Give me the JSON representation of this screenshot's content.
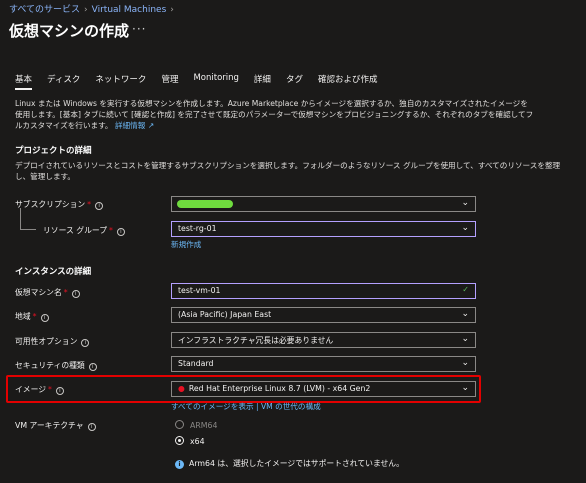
{
  "breadcrumb": {
    "item1": "すべてのサービス",
    "item2": "Virtual Machines"
  },
  "page": {
    "title": "仮想マシンの作成",
    "more": "···"
  },
  "tabs": [
    {
      "label": "基本"
    },
    {
      "label": "ディスク"
    },
    {
      "label": "ネットワーク"
    },
    {
      "label": "管理"
    },
    {
      "label": "Monitoring"
    },
    {
      "label": "詳細"
    },
    {
      "label": "タグ"
    },
    {
      "label": "確認および作成"
    }
  ],
  "intro": {
    "line1": "Linux または Windows を実行する仮想マシンを作成します。Azure Marketplace からイメージを選択するか、独自のカスタマイズされたイメージを",
    "line2": "使用します。[基本] タブに続いて [確認と作成] を完了させて既定のパラメーターで仮想マシンをプロビジョニングするか、それぞれのタブを確認してフ",
    "line3": "ルカスタマイズを行います。",
    "link": "詳細情報 ↗"
  },
  "project": {
    "heading": "プロジェクトの詳細",
    "desc1": "デプロイされているリソースとコストを管理するサブスクリプションを選択します。フォルダーのようなリソース グループを使用して、すべてのリソースを整理",
    "desc2": "し、管理します。",
    "subscription_label": "サブスクリプション",
    "rg_label": "リソース グループ",
    "rg_value": "test-rg-01",
    "rg_new": "新規作成"
  },
  "instance": {
    "heading": "インスタンスの詳細",
    "vmname_label": "仮想マシン名",
    "vmname_value": "test-vm-01",
    "region_label": "地域",
    "region_value": "(Asia Pacific) Japan East",
    "avail_label": "可用性オプション",
    "avail_value": "インフラストラクチャ冗長は必要ありません",
    "security_label": "セキュリティの種類",
    "security_value": "Standard",
    "image_label": "イメージ",
    "image_value": "Red Hat Enterprise Linux 8.7 (LVM) - x64 Gen2",
    "image_link1": "すべてのイメージを表示",
    "image_link_sep": " | ",
    "image_link2": "VM の世代の構成",
    "arch_label": "VM アーキテクチャ",
    "arch_opt1": "ARM64",
    "arch_opt2": "x64",
    "arch_note": "Arm64 は、選択したイメージではサポートされていません。"
  },
  "colors": {
    "accent_link": "#6cb8f6",
    "highlight_box": "#e30000",
    "subscription_pill": "#6fdc3e",
    "focus_border": "#b4a0ff"
  }
}
